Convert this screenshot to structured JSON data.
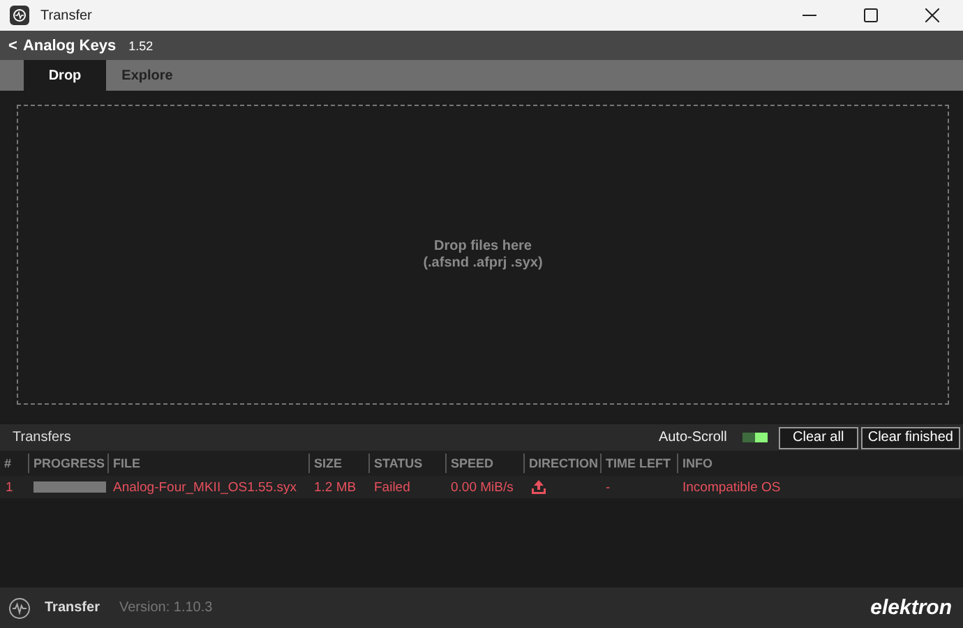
{
  "window": {
    "title": "Transfer"
  },
  "header": {
    "back": "<",
    "device": "Analog Keys",
    "version": "1.52"
  },
  "tabs": [
    {
      "label": "Drop",
      "selected": true
    },
    {
      "label": "Explore",
      "selected": false
    }
  ],
  "drop_zone": {
    "title": "Drop files here",
    "extensions": "(.afsnd .afprj .syx)"
  },
  "transfers": {
    "title": "Transfers",
    "auto_scroll": {
      "label": "Auto-Scroll",
      "on": true
    },
    "buttons": [
      "Clear all",
      "Clear finished"
    ],
    "columns": [
      "#",
      "PROGRESS",
      "FILE",
      "SIZE",
      "STATUS",
      "SPEED",
      "DIRECTION",
      "TIME LEFT",
      "INFO"
    ],
    "rows": [
      {
        "index": "1",
        "level": 1,
        "file": "Analog-Four_MKII_OS1.55.syx",
        "size": "1.2 MB",
        "status": "Failed",
        "speed": "0.00 MiB/s",
        "upload": true,
        "time_left": "-",
        "info": "Incompatible OS",
        "failed": true
      }
    ]
  },
  "footer": {
    "app": "Transfer",
    "version": "Version: 1.10.3",
    "brand": "elektron"
  }
}
